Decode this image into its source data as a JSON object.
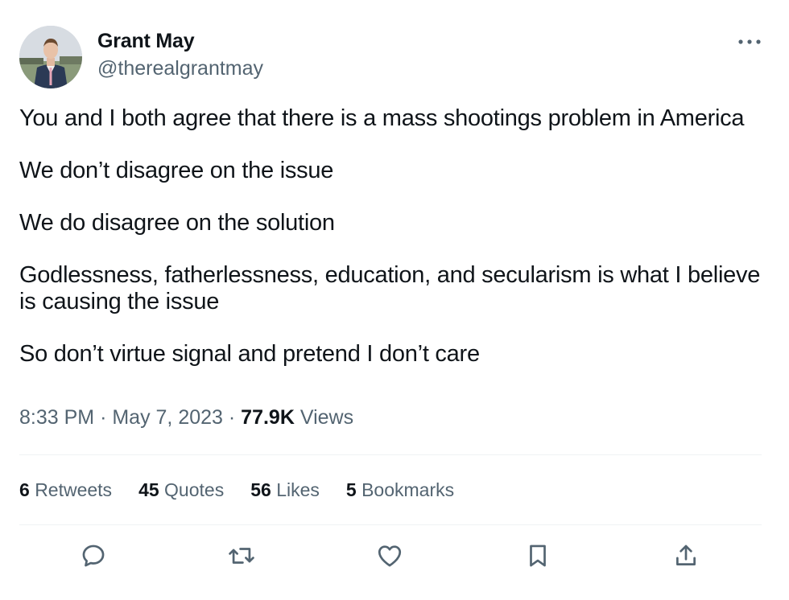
{
  "user": {
    "display_name": "Grant May",
    "handle": "@therealgrantmay",
    "avatar_icon": "profile-photo"
  },
  "menu": {
    "more_icon": "ellipsis-icon"
  },
  "tweet": {
    "paragraphs": [
      "You and I both agree that there is a mass shootings problem in America",
      "We don’t disagree on the issue",
      "We do disagree on the solution",
      "Godlessness, fatherlessness, education, and secularism is what I believe is causing the issue",
      "So don’t virtue signal and pretend I don’t care"
    ]
  },
  "meta": {
    "time": "8:33 PM",
    "separator": "·",
    "date": "May 7, 2023",
    "views_count": "77.9K",
    "views_label": "Views"
  },
  "stats": {
    "retweets": {
      "count": "6",
      "label": "Retweets"
    },
    "quotes": {
      "count": "45",
      "label": "Quotes"
    },
    "likes": {
      "count": "56",
      "label": "Likes"
    },
    "bookmarks": {
      "count": "5",
      "label": "Bookmarks"
    }
  },
  "actions": {
    "reply_icon": "reply-icon",
    "retweet_icon": "retweet-icon",
    "like_icon": "heart-icon",
    "bookmark_icon": "bookmark-icon",
    "share_icon": "share-icon"
  },
  "colors": {
    "primary_text": "#0f1419",
    "secondary_text": "#536471",
    "divider": "#eff3f4"
  }
}
